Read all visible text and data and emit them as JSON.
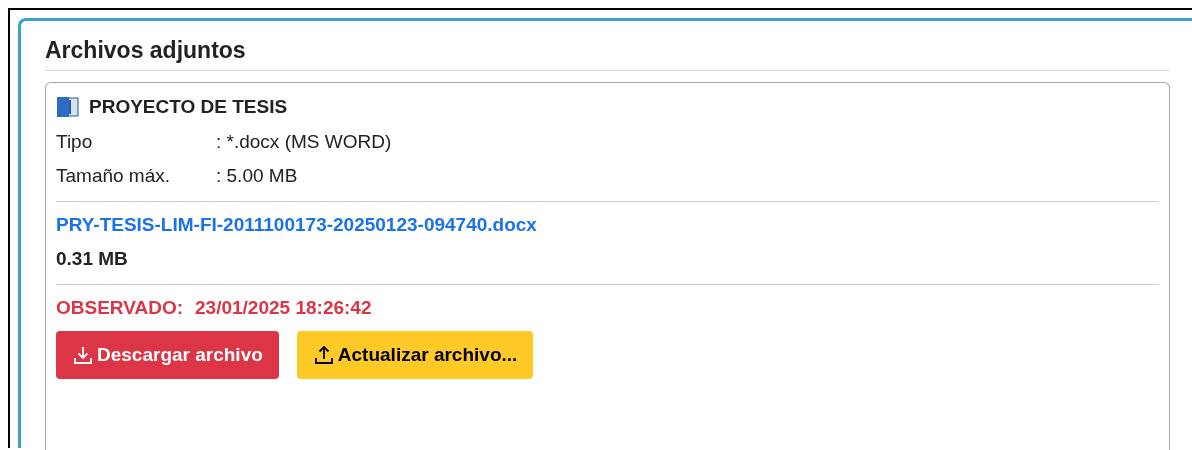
{
  "panel": {
    "title": "Archivos adjuntos"
  },
  "attachment": {
    "title": "PROYECTO DE TESIS",
    "fields": [
      {
        "label": "Tipo",
        "value": ": *.docx (MS WORD)"
      },
      {
        "label": "Tamaño máx.",
        "value": ": 5.00 MB"
      }
    ],
    "file": {
      "name": "PRY-TESIS-LIM-FI-2011100173-20250123-094740.docx",
      "size": "0.31 MB"
    },
    "status": {
      "label": "OBSERVADO:",
      "date": "23/01/2025 18:26:42"
    },
    "buttons": [
      {
        "label": "Descargar archivo",
        "kind": "download"
      },
      {
        "label": "Actualizar archivo...",
        "kind": "upload"
      }
    ]
  }
}
